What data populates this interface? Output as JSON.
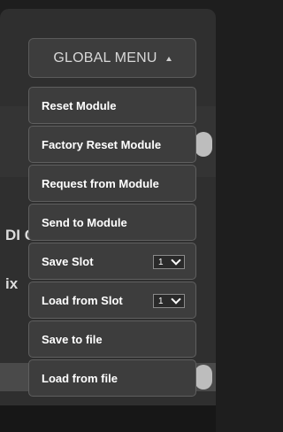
{
  "header": {
    "title": "GLOBAL MENU"
  },
  "background": {
    "partial_text_1": "DI C",
    "partial_text_2": "ix"
  },
  "menu": {
    "items": [
      {
        "label": "Reset Module"
      },
      {
        "label": "Factory Reset Module"
      },
      {
        "label": "Request from Module"
      },
      {
        "label": "Send to Module"
      },
      {
        "label": "Save Slot",
        "slot_value": "1"
      },
      {
        "label": "Load from Slot",
        "slot_value": "1"
      },
      {
        "label": "Save to file"
      },
      {
        "label": "Load from file"
      }
    ]
  },
  "icons": {
    "header_caret": "caret-up-icon",
    "slot_chevron": "chevron-down-icon"
  },
  "colors": {
    "page_bg": "#1e1e1e",
    "panel_bg": "#2f2f2f",
    "item_bg": "#3d3d3d",
    "item_border": "#5f5f5f",
    "text": "#ffffff"
  }
}
